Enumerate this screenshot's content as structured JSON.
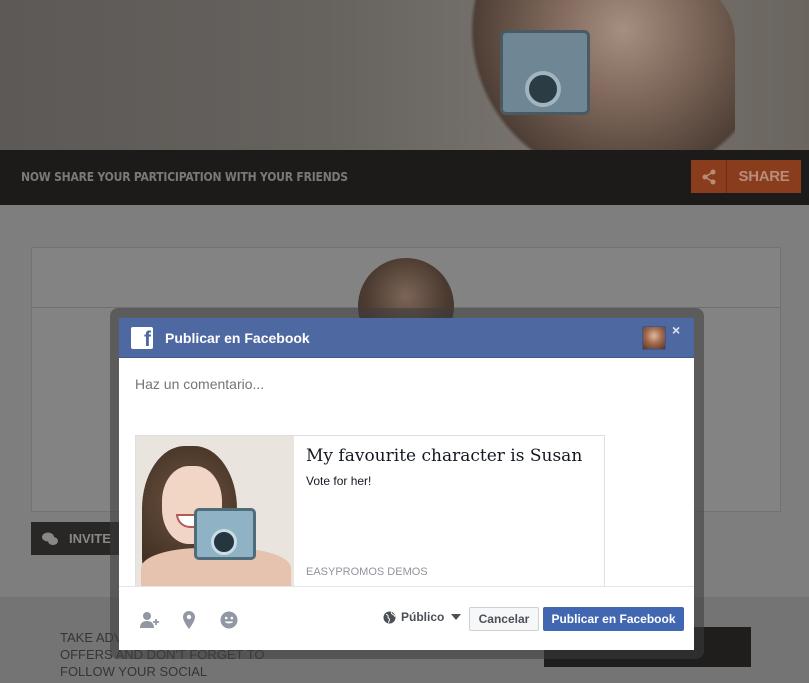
{
  "page": {
    "share_bar_text": "NOW SHARE YOUR PARTICIPATION WITH YOUR FRIENDS",
    "share_button_label": "SHARE",
    "invite_label": "INVITE",
    "footer_text": "TAKE ADVANTAGE OF ALL OUR OFFERS AND DON'T FORGET TO FOLLOW YOUR SOCIAL NETWORKS.",
    "share_icon": "share-icon",
    "invite_icon": "chat-bubbles-icon"
  },
  "dialog": {
    "title": "Publicar en Facebook",
    "logo_icon": "facebook-icon",
    "close_symbol": "×",
    "comment_placeholder": "Haz un comentario...",
    "preview": {
      "title": "My favourite character is Susan",
      "description": "Vote for her!",
      "source": "EASYPROMOS DEMOS"
    },
    "footer": {
      "icons": [
        "add-friend-icon",
        "location-pin-icon",
        "smiley-icon"
      ],
      "audience_label": "Público",
      "audience_icon": "globe-icon",
      "cancel_label": "Cancelar",
      "publish_label": "Publicar en Facebook"
    }
  },
  "colors": {
    "facebook_blue": "#4e69a2",
    "publish_button": "#4267b2",
    "share_accent": "#8a3d1c"
  }
}
